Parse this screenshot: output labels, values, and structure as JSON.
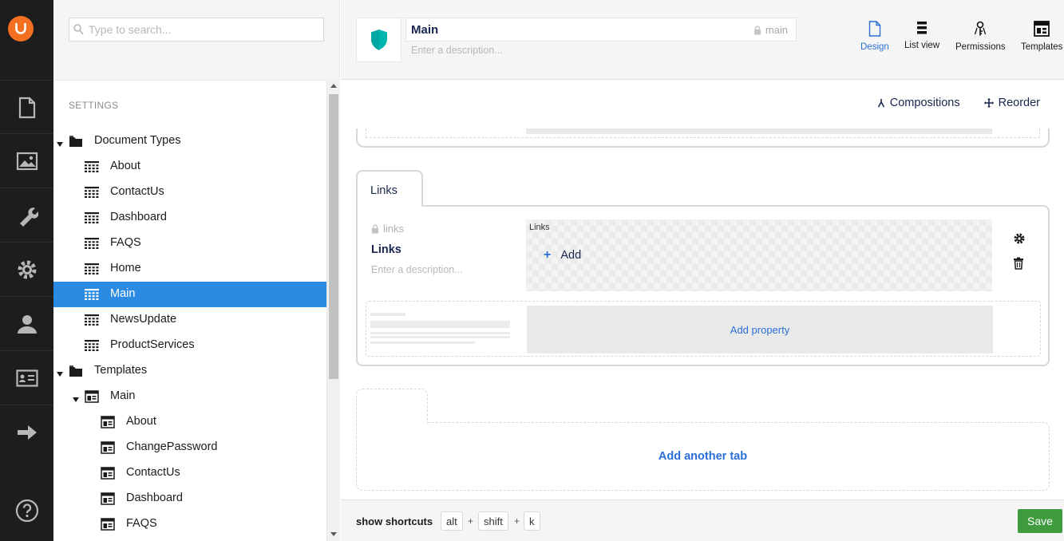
{
  "search": {
    "placeholder": "Type to search..."
  },
  "tree": {
    "section_label": "SETTINGS",
    "nodes": [
      {
        "label": "Document Types",
        "type": "folder",
        "expanded": true
      },
      {
        "label": "About",
        "type": "doctype"
      },
      {
        "label": "ContactUs",
        "type": "doctype"
      },
      {
        "label": "Dashboard",
        "type": "doctype"
      },
      {
        "label": "FAQS",
        "type": "doctype"
      },
      {
        "label": "Home",
        "type": "doctype"
      },
      {
        "label": "Main",
        "type": "doctype",
        "selected": true
      },
      {
        "label": "NewsUpdate",
        "type": "doctype"
      },
      {
        "label": "ProductServices",
        "type": "doctype"
      },
      {
        "label": "Templates",
        "type": "folder",
        "expanded": true
      },
      {
        "label": "Main",
        "type": "template",
        "expanded": true
      },
      {
        "label": "About",
        "type": "template"
      },
      {
        "label": "ChangePassword",
        "type": "template"
      },
      {
        "label": "ContactUs",
        "type": "template"
      },
      {
        "label": "Dashboard",
        "type": "template"
      },
      {
        "label": "FAQS",
        "type": "template"
      }
    ]
  },
  "header": {
    "name_value": "Main",
    "alias": "main",
    "description_placeholder": "Enter a description...",
    "apps": [
      {
        "label": "Design",
        "icon": "document-icon",
        "active": true
      },
      {
        "label": "List view",
        "icon": "list-icon"
      },
      {
        "label": "Permissions",
        "icon": "keys-icon"
      },
      {
        "label": "Templates",
        "icon": "layout-icon"
      }
    ]
  },
  "toolbar": {
    "compositions": "Compositions",
    "reorder": "Reorder"
  },
  "group": {
    "tab_label": "Links",
    "property": {
      "alias": "links",
      "name": "Links",
      "description_placeholder": "Enter a description...",
      "editor_label": "Links",
      "add_label": "Add"
    },
    "add_property": "Add property"
  },
  "add_tab": "Add another tab",
  "footer": {
    "shortcuts_label": "show shortcuts",
    "keys": [
      "alt",
      "shift",
      "k"
    ],
    "plus": "+",
    "save": "Save"
  },
  "colors": {
    "accent": "#2b8be3",
    "save": "#3e9c3f",
    "brand": "#f36f21",
    "icon_teal": "#00b5b0"
  }
}
